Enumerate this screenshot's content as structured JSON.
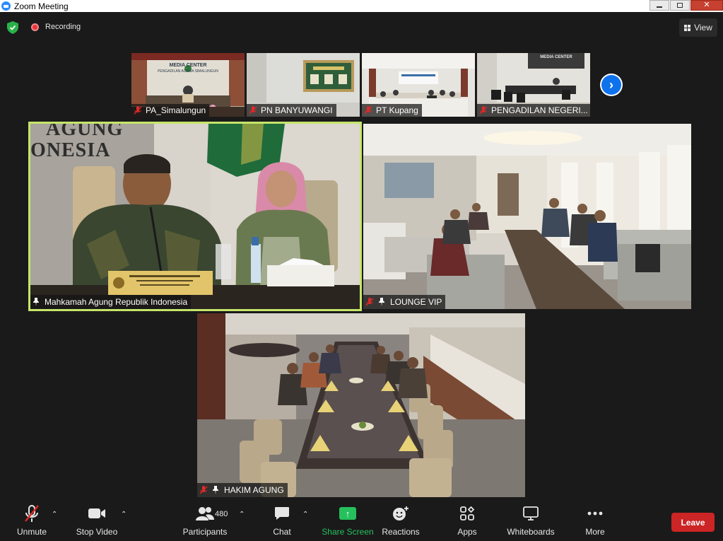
{
  "window": {
    "title": "Zoom Meeting"
  },
  "topbar": {
    "recording_label": "Recording",
    "view_label": "View"
  },
  "thumbnails": [
    {
      "name": "PA_Simalungun",
      "sign_text": "MEDIA CENTER",
      "sign_sub": "PENGADILAN AGAMA SIMALUNGUN"
    },
    {
      "name": "PN BANYUWANGI"
    },
    {
      "name": "PT Kupang"
    },
    {
      "name": "PENGADILAN NEGERI...",
      "sign_text": "MEDIA CENTER"
    }
  ],
  "main_tiles": [
    {
      "name": "Mahkamah Agung Republik Indonesia",
      "wall_text_1": "AGUNG",
      "wall_text_2": "ONESIA"
    },
    {
      "name": "LOUNGE VIP"
    },
    {
      "name": "HAKIM AGUNG"
    }
  ],
  "toolbar": {
    "unmute": "Unmute",
    "stop_video": "Stop Video",
    "participants": "Participants",
    "participants_count": "480",
    "chat": "Chat",
    "share_screen": "Share Screen",
    "reactions": "Reactions",
    "apps": "Apps",
    "whiteboards": "Whiteboards",
    "more": "More",
    "leave": "Leave"
  },
  "colors": {
    "active_speaker_border": "#c5e56a",
    "share_green": "#26c05c",
    "leave_red": "#cc2525",
    "next_arrow_blue": "#0e72ed"
  },
  "icons": [
    "zoom-app-icon",
    "security-shield-icon",
    "recording-dot-icon",
    "grid-view-icon",
    "next-page-arrow-icon",
    "mic-muted-icon",
    "pin-icon",
    "video-camera-icon",
    "participants-icon",
    "chat-icon",
    "share-screen-icon",
    "reactions-icon",
    "apps-icon",
    "whiteboard-icon",
    "more-icon"
  ]
}
